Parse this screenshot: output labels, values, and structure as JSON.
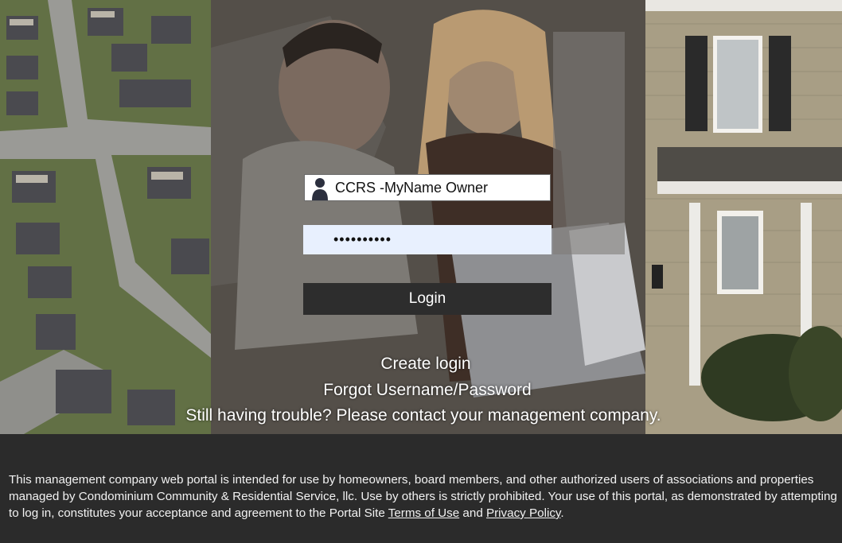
{
  "login": {
    "username_value": "CCRS -MyName Owner",
    "password_value": "••••••••••",
    "login_label": "Login"
  },
  "links": {
    "create_login": "Create login",
    "forgot": "Forgot Username/Password",
    "trouble": "Still having trouble? Please contact your management company."
  },
  "footer": {
    "text_before": "This management company web portal is intended for use by homeowners, board members, and other authorized users of associations and properties managed by Condominium Community & Residential Service, llc. Use by others is strictly prohibited. Your use of this portal, as demonstrated by attempting to log in, constitutes your acceptance and agreement to the Portal Site ",
    "terms_label": "Terms of Use",
    "and_text": " and ",
    "privacy_label": "Privacy Policy",
    "period": "."
  },
  "icons": {
    "user": "user-icon"
  },
  "colors": {
    "footer_bg": "#2b2b2b",
    "autofill_bg": "#e8f0fe",
    "button_bg": "#2d2d2d"
  }
}
